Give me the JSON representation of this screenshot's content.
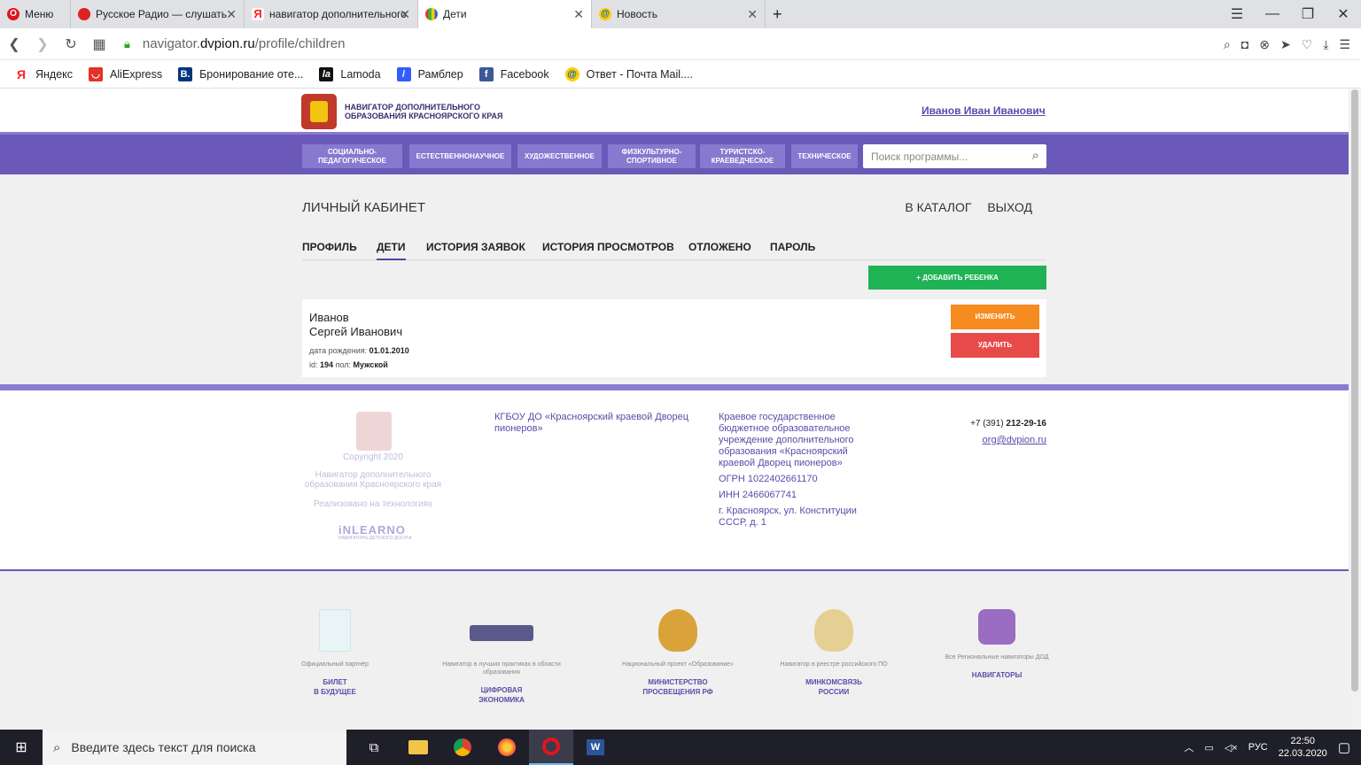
{
  "browser": {
    "menu_label": "Меню",
    "tabs": [
      {
        "title": "Русское Радио — слушать"
      },
      {
        "title": "навигатор дополнительного"
      },
      {
        "title": "Дети"
      },
      {
        "title": "Новость"
      }
    ],
    "url_prefix": "navigator.",
    "url_domain": "dvpion.ru",
    "url_path": "/profile/children",
    "bookmarks": [
      {
        "label": "Яндекс"
      },
      {
        "label": "AliExpress"
      },
      {
        "label": "Бронирование оте..."
      },
      {
        "label": "Lamoda"
      },
      {
        "label": "Рамблер"
      },
      {
        "label": "Facebook"
      },
      {
        "label": "Ответ - Почта Mail...."
      }
    ]
  },
  "site": {
    "name_line1": "НАВИГАТОР ДОПОЛНИТЕЛЬНОГО",
    "name_line2": "ОБРАЗОВАНИЯ КРАСНОЯРСКОГО КРАЯ",
    "user_name": "Иванов Иван Иванович",
    "categories": [
      {
        "line1": "СОЦИАЛЬНО-",
        "line2": "ПЕДАГОГИЧЕСКОЕ"
      },
      {
        "line1": "ЕСТЕСТВЕННОНАУЧНОЕ",
        "line2": ""
      },
      {
        "line1": "ХУДОЖЕСТВЕННОЕ",
        "line2": ""
      },
      {
        "line1": "ФИЗКУЛЬТУРНО-",
        "line2": "СПОРТИВНОЕ"
      },
      {
        "line1": "ТУРИСТСКО-",
        "line2": "КРАЕВЕДЧЕСКОЕ"
      },
      {
        "line1": "ТЕХНИЧЕСКОЕ",
        "line2": ""
      }
    ],
    "search_placeholder": "Поиск программы..."
  },
  "cabinet": {
    "title": "ЛИЧНЫЙ КАБИНЕТ",
    "catalog_link": "В КАТАЛОГ",
    "logout_link": "ВЫХОД",
    "tabs": [
      {
        "label": "ПРОФИЛЬ"
      },
      {
        "label": "ДЕТИ"
      },
      {
        "label": "ИСТОРИЯ ЗАЯВОК"
      },
      {
        "label": "ИСТОРИЯ ПРОСМОТРОВ"
      },
      {
        "label": "ОТЛОЖЕНО"
      },
      {
        "label": "ПАРОЛЬ"
      }
    ],
    "add_child_label": "+ ДОБАВИТЬ РЕБЕНКА",
    "child": {
      "surname": "Иванов",
      "name": "Сергей Иванович",
      "birth_label": "дата рождения:",
      "birth_value": "01.01.2010",
      "id_label": "id:",
      "id_value": "194",
      "gender_label": "пол:",
      "gender_value": "Мужской",
      "edit_label": "ИЗМЕНИТЬ",
      "delete_label": "УДАЛИТЬ"
    }
  },
  "footer": {
    "copyright": "Copyright 2020",
    "navigator_name": "Навигатор дополнительного образования Красноярского края",
    "tech_label": "Реализовано на технологиях",
    "inlearno": "iNLEARNO",
    "inlearno_sub": "НАВИГАТОРЫ ДЕТСКОГО ДОСУГА",
    "org_short": "КГБОУ ДО «Красноярский краевой Дворец пионеров»",
    "org_full": "Краевое государственное бюджетное образовательное учреждение дополнительного образования «Красноярский краевой Дворец пионеров»",
    "ogrn": "ОГРН 1022402661170",
    "inn": "ИНН 2466067741",
    "address": "г. Красноярск, ул. Конституции СССР, д. 1",
    "phone_prefix": "+7 (391)",
    "phone_number": "212-29-16",
    "email": "org@dvpion.ru"
  },
  "partners": [
    {
      "caption": "Официальный партнёр",
      "title_line1": "БИЛЕТ",
      "title_line2": "В БУДУЩЕЕ"
    },
    {
      "caption": "Навигатор в лучших практиках в области образования",
      "title_line1": "ЦИФРОВАЯ",
      "title_line2": "ЭКОНОМИКА"
    },
    {
      "caption": "Национальный проект «Образование»",
      "title_line1": "МИНИСТЕРСТВО",
      "title_line2": "ПРОСВЕЩЕНИЯ РФ"
    },
    {
      "caption": "Навигатор в реестре российского ПО",
      "title_line1": "МИНКОМСВЯЗЬ",
      "title_line2": "РОССИИ"
    },
    {
      "caption": "Все Региональные навигаторы ДОД",
      "title_line1": "НАВИГАТОРЫ",
      "title_line2": ""
    }
  ],
  "taskbar": {
    "search_placeholder": "Введите здесь текст для поиска",
    "lang": "РУС",
    "time": "22:50",
    "date": "22.03.2020"
  },
  "colors": {
    "purple": "#6a59b8",
    "green": "#20b356",
    "orange": "#f68b1f",
    "red": "#e84a4a"
  }
}
